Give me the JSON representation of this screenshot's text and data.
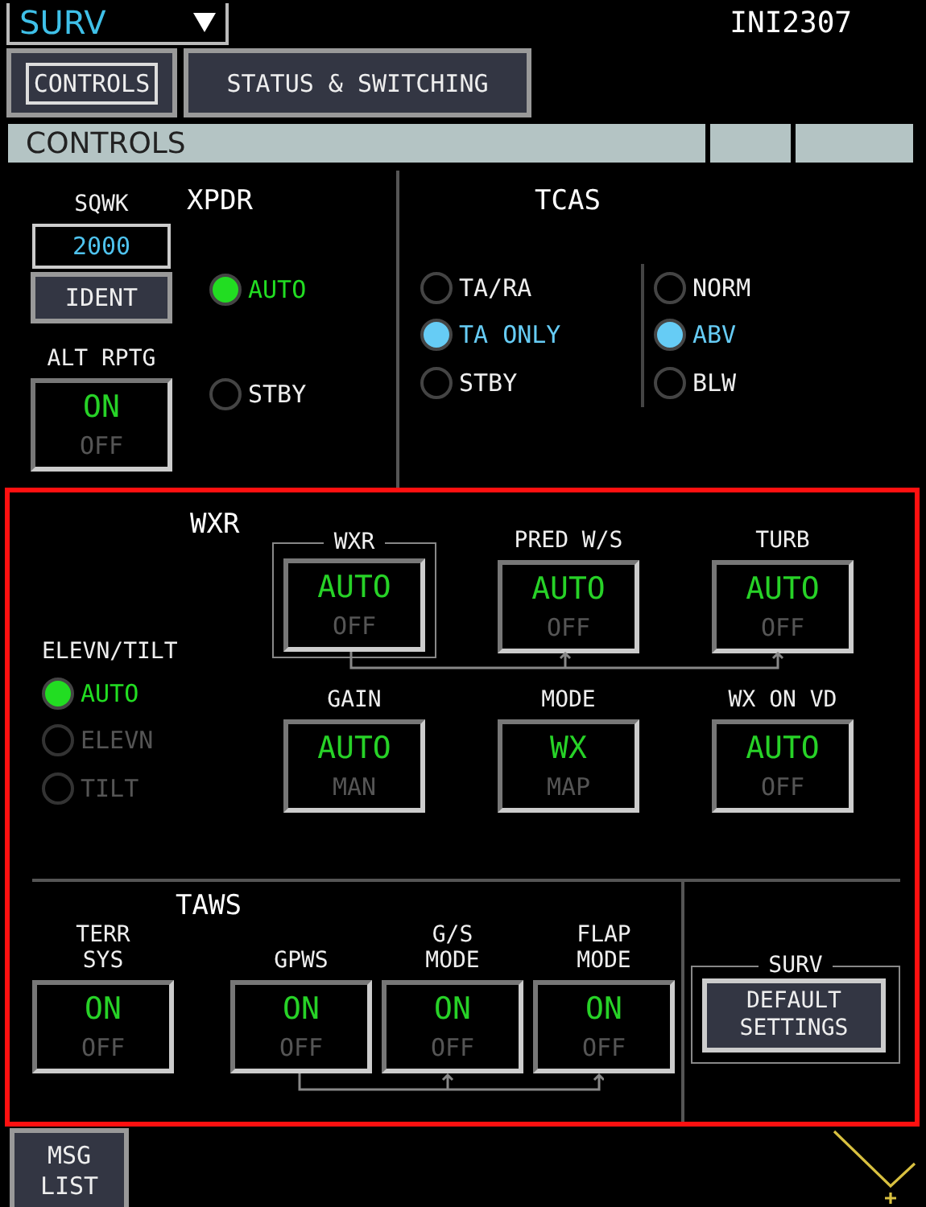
{
  "header": {
    "system_menu": "SURV",
    "flight_id": "INI2307"
  },
  "tabs": [
    {
      "label": "CONTROLS",
      "selected": true
    },
    {
      "label": "STATUS & SWITCHING",
      "selected": false
    }
  ],
  "title_bar": {
    "title": "CONTROLS"
  },
  "xpdr": {
    "title": "XPDR",
    "squawk_label": "SQWK",
    "squawk_value": "2000",
    "ident_button": "IDENT",
    "alt_rptg": {
      "label": "ALT RPTG",
      "options": [
        {
          "text": "ON",
          "selected": true
        },
        {
          "text": "OFF",
          "selected": false
        }
      ]
    },
    "modes": [
      {
        "label": "AUTO",
        "selected": true
      },
      {
        "label": "STBY",
        "selected": false
      }
    ]
  },
  "tcas": {
    "title": "TCAS",
    "modes": [
      {
        "label": "TA/RA",
        "selected": false
      },
      {
        "label": "TA ONLY",
        "selected": true
      },
      {
        "label": "STBY",
        "selected": false
      }
    ],
    "display": [
      {
        "label": "NORM",
        "selected": false
      },
      {
        "label": "ABV",
        "selected": true
      },
      {
        "label": "BLW",
        "selected": false
      }
    ]
  },
  "wxr": {
    "title": "WXR",
    "elevn_tilt": {
      "label": "ELEVN/TILT",
      "options": [
        {
          "label": "AUTO",
          "selected": true,
          "disabled": false
        },
        {
          "label": "ELEVN",
          "selected": false,
          "disabled": true
        },
        {
          "label": "TILT",
          "selected": false,
          "disabled": true
        }
      ]
    },
    "switches": [
      {
        "label": "WXR",
        "options": [
          {
            "text": "AUTO",
            "selected": true
          },
          {
            "text": "OFF",
            "selected": false
          }
        ]
      },
      {
        "label": "PRED W/S",
        "options": [
          {
            "text": "AUTO",
            "selected": true
          },
          {
            "text": "OFF",
            "selected": false
          }
        ]
      },
      {
        "label": "TURB",
        "options": [
          {
            "text": "AUTO",
            "selected": true
          },
          {
            "text": "OFF",
            "selected": false
          }
        ]
      },
      {
        "label": "GAIN",
        "options": [
          {
            "text": "AUTO",
            "selected": true
          },
          {
            "text": "MAN",
            "selected": false
          }
        ]
      },
      {
        "label": "MODE",
        "options": [
          {
            "text": "WX",
            "selected": true
          },
          {
            "text": "MAP",
            "selected": false
          }
        ]
      },
      {
        "label": "WX ON VD",
        "options": [
          {
            "text": "AUTO",
            "selected": true
          },
          {
            "text": "OFF",
            "selected": false
          }
        ]
      }
    ]
  },
  "taws": {
    "title": "TAWS",
    "switches": [
      {
        "label": "TERR\nSYS",
        "options": [
          {
            "text": "ON",
            "selected": true
          },
          {
            "text": "OFF",
            "selected": false
          }
        ]
      },
      {
        "label": "GPWS",
        "options": [
          {
            "text": "ON",
            "selected": true
          },
          {
            "text": "OFF",
            "selected": false
          }
        ]
      },
      {
        "label": "G/S\nMODE",
        "options": [
          {
            "text": "ON",
            "selected": true
          },
          {
            "text": "OFF",
            "selected": false
          }
        ]
      },
      {
        "label": "FLAP\nMODE",
        "options": [
          {
            "text": "ON",
            "selected": true
          },
          {
            "text": "OFF",
            "selected": false
          }
        ]
      }
    ]
  },
  "surv": {
    "title": "SURV",
    "default_button": "DEFAULT\nSETTINGS"
  },
  "msg_list_button": "MSG\nLIST"
}
